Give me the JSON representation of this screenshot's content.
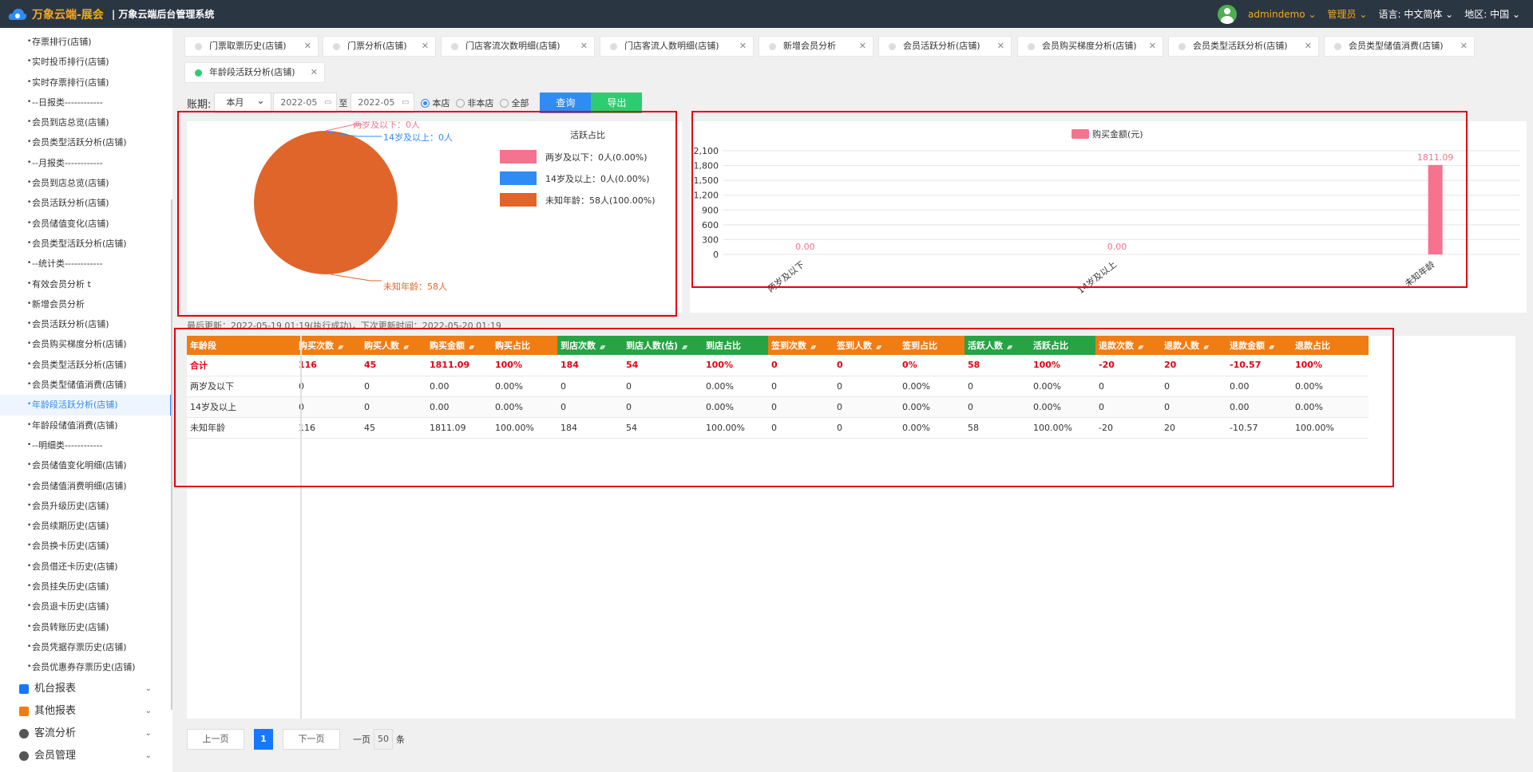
{
  "app": {
    "brand": "万象云端-展会",
    "system": "万象云端后台管理系统",
    "user": "admindemo",
    "role": "管理员",
    "lang_label": "语言:",
    "lang_value": "中文简体",
    "region_label": "地区:",
    "region_value": "中国"
  },
  "sidebar": {
    "items": [
      "存票排行(店铺)",
      "实时投币排行(店铺)",
      "实时存票排行(店铺)",
      "--日报类------------",
      "会员到店总览(店铺)",
      "会员类型活跃分析(店铺)",
      "--月报类------------",
      "会员到店总览(店铺)",
      "会员活跃分析(店铺)",
      "会员储值变化(店铺)",
      "会员类型活跃分析(店铺)",
      "--统计类------------",
      "有效会员分析 t",
      "新增会员分析",
      "会员活跃分析(店铺)",
      "会员购买梯度分析(店铺)",
      "会员类型活跃分析(店铺)",
      "会员类型储值消费(店铺)",
      "年龄段活跃分析(店铺)",
      "年龄段储值消费(店铺)",
      "--明细类------------",
      "会员储值变化明细(店铺)",
      "会员储值消费明细(店铺)",
      "会员升级历史(店铺)",
      "会员续期历史(店铺)",
      "会员换卡历史(店铺)",
      "会员借还卡历史(店铺)",
      "会员挂失历史(店铺)",
      "会员退卡历史(店铺)",
      "会员转账历史(店铺)",
      "会员凭据存票历史(店铺)",
      "会员优惠券存票历史(店铺)"
    ],
    "active_index": 18,
    "groups": [
      {
        "label": "机台报表",
        "color": "#1677ff"
      },
      {
        "label": "其他报表",
        "color": "#f07c14"
      },
      {
        "label": "客流分析",
        "color": "#555"
      },
      {
        "label": "会员管理",
        "color": "#555"
      }
    ]
  },
  "tabs": [
    {
      "label": "门票取票历史(店铺)",
      "active": false
    },
    {
      "label": "门票分析(店铺)",
      "active": false
    },
    {
      "label": "门店客流次数明细(店铺)",
      "active": false
    },
    {
      "label": "门店客流人数明细(店铺)",
      "active": false
    },
    {
      "label": "新增会员分析",
      "active": false
    },
    {
      "label": "会员活跃分析(店铺)",
      "active": false
    },
    {
      "label": "会员购买梯度分析(店铺)",
      "active": false
    },
    {
      "label": "会员类型活跃分析(店铺)",
      "active": false
    },
    {
      "label": "会员类型储值消费(店铺)",
      "active": false
    },
    {
      "label": "年龄段活跃分析(店铺)",
      "active": true
    }
  ],
  "filter": {
    "period_label": "账期:",
    "period_value": "本月",
    "date_from": "2022-05",
    "to_label": "至",
    "date_to": "2022-05",
    "radios": [
      {
        "label": "本店",
        "checked": true
      },
      {
        "label": "非本店",
        "checked": false
      },
      {
        "label": "全部",
        "checked": false
      }
    ],
    "query_button": "查询",
    "export_button": "导出"
  },
  "chart_data": [
    {
      "type": "pie",
      "title": "活跃占比",
      "categories": [
        "两岁及以下",
        "14岁及以上",
        "未知年龄"
      ],
      "values": [
        0,
        0,
        58
      ],
      "colors": [
        "#f5738e",
        "#2f8cf4",
        "#e0652b"
      ],
      "slice_labels": [
        "两岁及以下：0人",
        "14岁及以上：0人",
        "未知年龄：58人"
      ],
      "legend": [
        "两岁及以下：0人(0.00%)",
        "14岁及以上：0人(0.00%)",
        "未知年龄：58人(100.00%)"
      ],
      "legend_position": "right"
    },
    {
      "type": "bar",
      "series": [
        {
          "name": "购买金额(元)",
          "values": [
            0,
            0,
            1811.09
          ],
          "color": "#f5738e"
        }
      ],
      "categories": [
        "两岁及以下",
        "14岁及以上",
        "未知年龄"
      ],
      "data_labels": [
        "0.00",
        "0.00",
        "1811.09"
      ],
      "yticks": [
        "0",
        "300",
        "600",
        "900",
        "1,200",
        "1,500",
        "1,800",
        "2,100"
      ],
      "ylim": [
        0,
        2100
      ],
      "grid": true,
      "legend_position": "top"
    }
  ],
  "update_text": "最后更新：2022-05-19 01:19(执行成功)，下次更新时间：2022-05-20 01:19",
  "table": {
    "columns": [
      {
        "label": "年龄段",
        "c": "o",
        "sort": false
      },
      {
        "label": "购买次数",
        "c": "o",
        "sort": true
      },
      {
        "label": "购买人数",
        "c": "o",
        "sort": true
      },
      {
        "label": "购买金额",
        "c": "o",
        "sort": true
      },
      {
        "label": "购买占比",
        "c": "o",
        "sort": false
      },
      {
        "label": "到店次数",
        "c": "g",
        "sort": true
      },
      {
        "label": "到店人数(估)",
        "c": "g",
        "sort": true
      },
      {
        "label": "到店占比",
        "c": "g",
        "sort": false
      },
      {
        "label": "签到次数",
        "c": "o",
        "sort": true
      },
      {
        "label": "签到人数",
        "c": "o",
        "sort": true
      },
      {
        "label": "签到占比",
        "c": "o",
        "sort": false
      },
      {
        "label": "活跃人数",
        "c": "g",
        "sort": true
      },
      {
        "label": "活跃占比",
        "c": "g",
        "sort": false
      },
      {
        "label": "退款次数",
        "c": "o",
        "sort": true
      },
      {
        "label": "退款人数",
        "c": "o",
        "sort": true
      },
      {
        "label": "退款金额",
        "c": "o",
        "sort": true
      },
      {
        "label": "退款占比",
        "c": "o",
        "sort": false
      }
    ],
    "rows": [
      [
        "合计",
        "116",
        "45",
        "1811.09",
        "100%",
        "184",
        "54",
        "100%",
        "0",
        "0",
        "0%",
        "58",
        "100%",
        "-20",
        "20",
        "-10.57",
        "100%"
      ],
      [
        "两岁及以下",
        "0",
        "0",
        "0.00",
        "0.00%",
        "0",
        "0",
        "0.00%",
        "0",
        "0",
        "0.00%",
        "0",
        "0.00%",
        "0",
        "0",
        "0.00",
        "0.00%"
      ],
      [
        "14岁及以上",
        "0",
        "0",
        "0.00",
        "0.00%",
        "0",
        "0",
        "0.00%",
        "0",
        "0",
        "0.00%",
        "0",
        "0.00%",
        "0",
        "0",
        "0.00",
        "0.00%"
      ],
      [
        "未知年龄",
        "116",
        "45",
        "1811.09",
        "100.00%",
        "184",
        "54",
        "100.00%",
        "0",
        "0",
        "0.00%",
        "58",
        "100.00%",
        "-20",
        "20",
        "-10.57",
        "100.00%"
      ]
    ]
  },
  "pager": {
    "prev": "上一页",
    "current": "1",
    "next": "下一页",
    "per_label": "一页",
    "per_value": "50",
    "per_unit": "条"
  }
}
